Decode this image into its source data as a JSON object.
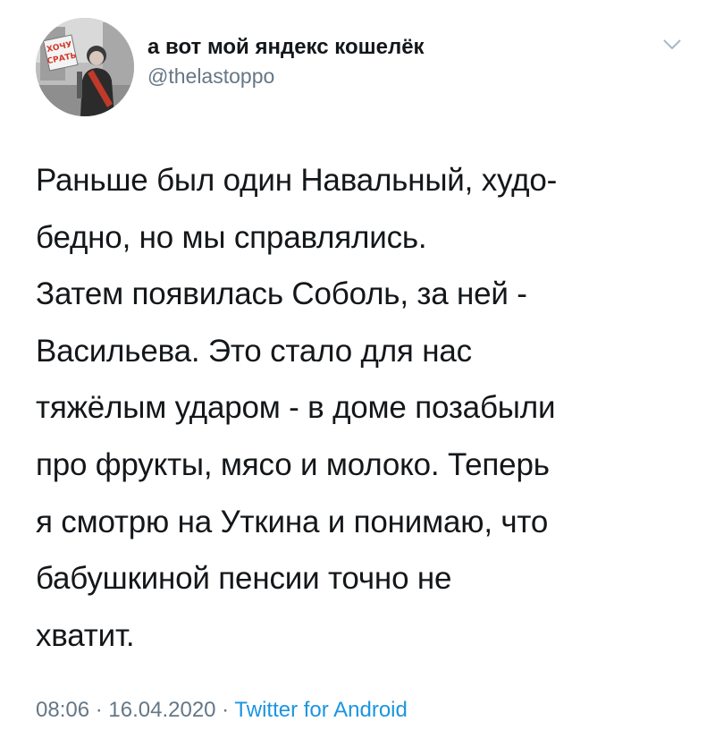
{
  "tweet": {
    "display_name": "а вот мой яндекс кошелёк",
    "handle": "@thelastoppo",
    "avatar_sign_text": "ХОЧУ СРАТЬ",
    "menu_icon": "chevron-down-icon",
    "text": "Раньше был один Навальный, худо-\nбедно, но мы справлялись.\nЗатем появилась Соболь, за ней -\nВасильева. Это стало для нас\nтяжёлым ударом - в доме позабыли\nпро фрукты, мясо и молоко. Теперь\nя смотрю на Уткина и понимаю, что\nбабушкиной пенсии точно не\nхватит.",
    "time": "08:06",
    "separator_1": " · ",
    "date": "16.04.2020",
    "separator_2": " · ",
    "source": "Twitter for Android"
  },
  "colors": {
    "text_primary": "#14171a",
    "text_secondary": "#657786",
    "link": "#1b95e0",
    "background": "#ffffff"
  }
}
